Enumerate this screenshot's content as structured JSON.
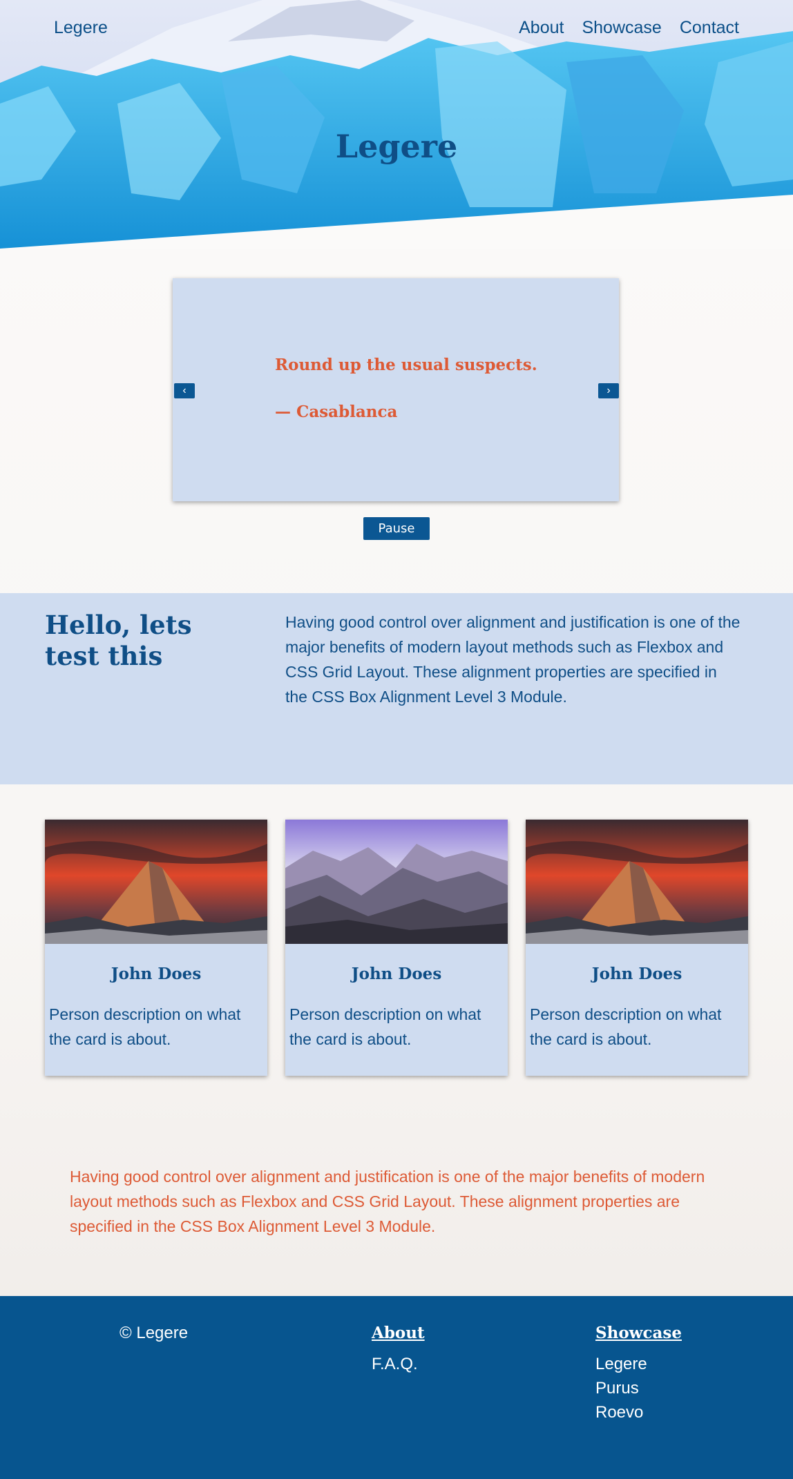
{
  "header": {
    "logo": "Legere",
    "nav": [
      "About",
      "Showcase",
      "Contact"
    ],
    "title": "Legere"
  },
  "carousel": {
    "quote": "Round up the usual suspects.",
    "source": "— Casablanca",
    "prev_label": "‹",
    "next_label": "›",
    "pause_label": "Pause"
  },
  "intro": {
    "heading": "Hello, lets test this",
    "text": "Having good control over alignment and justification is one of the major benefits of modern layout methods such as Flexbox and CSS Grid Layout. These alignment properties are specified in the CSS Box Alignment Level 3 Module."
  },
  "cards": [
    {
      "name": "John Does",
      "description": "Person description on what the card is about."
    },
    {
      "name": "John Does",
      "description": "Person description on what the card is about."
    },
    {
      "name": "John Does",
      "description": "Person description on what the card is about."
    }
  ],
  "bottom_text": "Having good control over alignment and justification is one of the major benefits of modern layout methods such as Flexbox and CSS Grid Layout. These alignment properties are specified in the CSS Box Alignment Level 3 Module.",
  "footer": {
    "copyright": "© Legere",
    "about": {
      "heading": "About",
      "links": [
        "F.A.Q."
      ]
    },
    "showcase": {
      "heading": "Showcase",
      "links": [
        "Legere",
        "Purus",
        "Roevo"
      ]
    }
  },
  "colors": {
    "primary": "#0b4f88",
    "accent": "#dd5a35",
    "panel": "#cfdcf0",
    "footer": "#07558f"
  }
}
